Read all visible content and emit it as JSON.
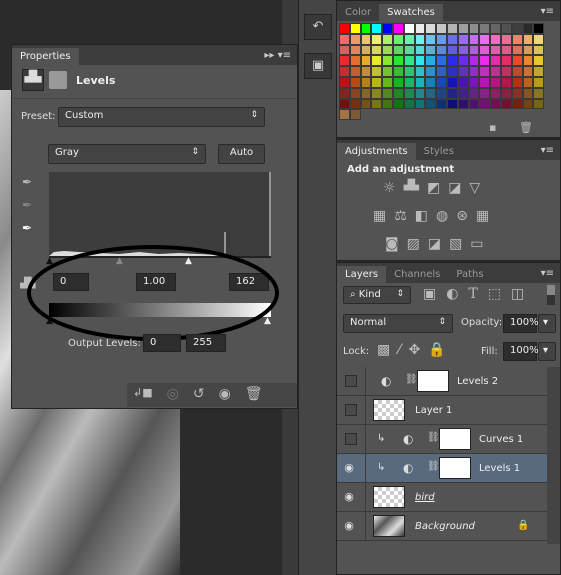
{
  "properties": {
    "tab": "Properties",
    "title": "Levels",
    "preset_label": "Preset:",
    "preset_value": "Custom",
    "channel": "Gray",
    "auto_label": "Auto",
    "input_black": "0",
    "input_gamma": "1.00",
    "input_white": "162",
    "output_label": "Output Levels:",
    "output_black": "0",
    "output_white": "255"
  },
  "swatches": {
    "tabs": [
      "Color",
      "Swatches"
    ],
    "active": "Swatches"
  },
  "adjustments": {
    "tabs": [
      "Adjustments",
      "Styles"
    ],
    "heading": "Add an adjustment"
  },
  "layers": {
    "tabs": [
      "Layers",
      "Channels",
      "Paths"
    ],
    "filter": "Kind",
    "blend_mode": "Normal",
    "opacity_label": "Opacity:",
    "opacity": "100%",
    "lock_label": "Lock:",
    "fill_label": "Fill:",
    "fill": "100%",
    "items": [
      {
        "name": "Levels 2",
        "visible": false,
        "type": "adjustment"
      },
      {
        "name": "Layer 1",
        "visible": false,
        "type": "pixel"
      },
      {
        "name": "Curves 1",
        "visible": false,
        "type": "adjustment",
        "clipped": true
      },
      {
        "name": "Levels 1",
        "visible": true,
        "type": "adjustment",
        "clipped": true,
        "selected": true
      },
      {
        "name": "bird",
        "visible": true,
        "type": "pixel"
      },
      {
        "name": "Background",
        "visible": true,
        "type": "pixel",
        "locked": true
      }
    ]
  },
  "colors": {
    "panel": "#535353",
    "selected_row": "#5a6a7e",
    "ellipse": "#000000"
  }
}
